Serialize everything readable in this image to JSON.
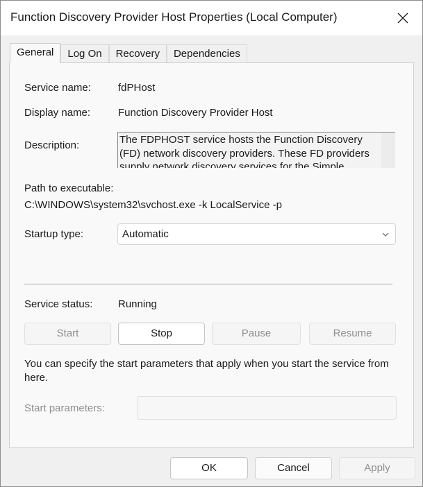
{
  "window": {
    "title": "Function Discovery Provider Host Properties (Local Computer)"
  },
  "tabs": [
    {
      "label": "General",
      "active": true
    },
    {
      "label": "Log On",
      "active": false
    },
    {
      "label": "Recovery",
      "active": false
    },
    {
      "label": "Dependencies",
      "active": false
    }
  ],
  "general": {
    "service_name_label": "Service name:",
    "service_name": "fdPHost",
    "display_name_label": "Display name:",
    "display_name": "Function Discovery Provider Host",
    "description_label": "Description:",
    "description": "The FDPHOST service hosts the Function Discovery (FD) network discovery providers. These FD providers supply network discovery services for the Simple",
    "path_label": "Path to executable:",
    "path": "C:\\WINDOWS\\system32\\svchost.exe -k LocalService -p",
    "startup_type_label": "Startup type:",
    "startup_type": "Automatic",
    "service_status_label": "Service status:",
    "service_status": "Running",
    "buttons": {
      "start": "Start",
      "stop": "Stop",
      "pause": "Pause",
      "resume": "Resume"
    },
    "info_text": "You can specify the start parameters that apply when you start the service from here.",
    "start_params_label": "Start parameters:",
    "start_params_value": ""
  },
  "footer": {
    "ok": "OK",
    "cancel": "Cancel",
    "apply": "Apply"
  },
  "icons": {
    "close": "close-icon",
    "dropdown": "chevron-down-icon"
  }
}
